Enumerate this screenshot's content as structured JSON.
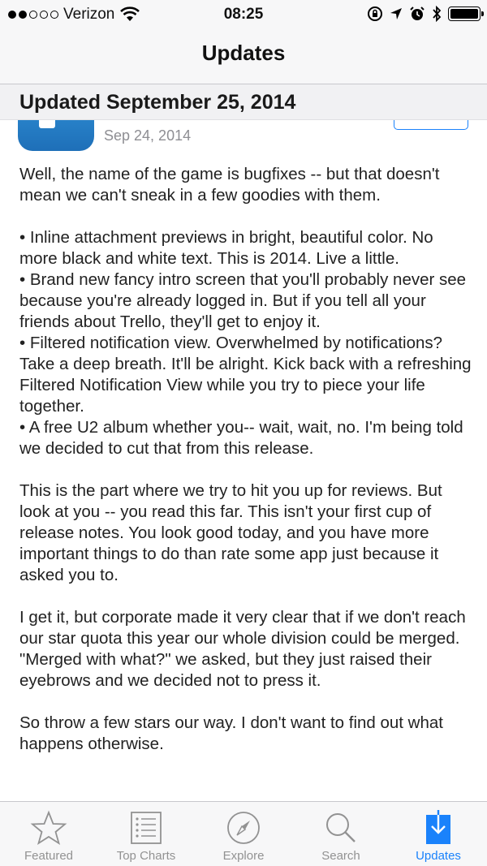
{
  "status_bar": {
    "carrier": "Verizon",
    "time": "08:25"
  },
  "nav": {
    "title": "Updates"
  },
  "section": {
    "header": "Updated September 25, 2014"
  },
  "app": {
    "icon": "trello-app-icon",
    "date": "Sep 24, 2014"
  },
  "release_notes": {
    "intro": "Well, the name of the game is bugfixes -- but that doesn't mean we can't sneak in a few goodies with them.",
    "bullets": [
      "• Inline attachment previews in bright, beautiful color. No more black and white text. This is 2014. Live a little.",
      "• Brand new fancy intro screen that you'll probably never see because you're already logged in. But if you tell all your friends about Trello, they'll get to enjoy it.",
      "• Filtered notification view. Overwhelmed by notifications? Take a deep breath. It'll be alright. Kick back with a refreshing Filtered Notification View while you try to piece your life together.",
      "• A free U2 album whether you-- wait, wait, no. I'm being told we decided to cut that from this release."
    ],
    "para2": "This is the part where we try to hit you up for reviews. But look at you -- you read this far. This isn't your first cup of release notes. You look good today, and you have more important things to do than rate some app just because it asked you to.",
    "para3": "I get it, but corporate made it very clear that if we don't reach our star quota this year our whole division could be merged. \"Merged with what?\" we asked, but they just raised their eyebrows and we decided not to press it.",
    "para4": "So throw a few stars our way. I don't want to find out what happens otherwise."
  },
  "tabbar": {
    "tabs": [
      {
        "label": "Featured",
        "icon": "star-icon"
      },
      {
        "label": "Top Charts",
        "icon": "list-icon"
      },
      {
        "label": "Explore",
        "icon": "compass-icon"
      },
      {
        "label": "Search",
        "icon": "search-icon"
      },
      {
        "label": "Updates",
        "icon": "download-icon"
      }
    ],
    "active_color": "#1a82fb",
    "inactive_color": "#929292"
  }
}
